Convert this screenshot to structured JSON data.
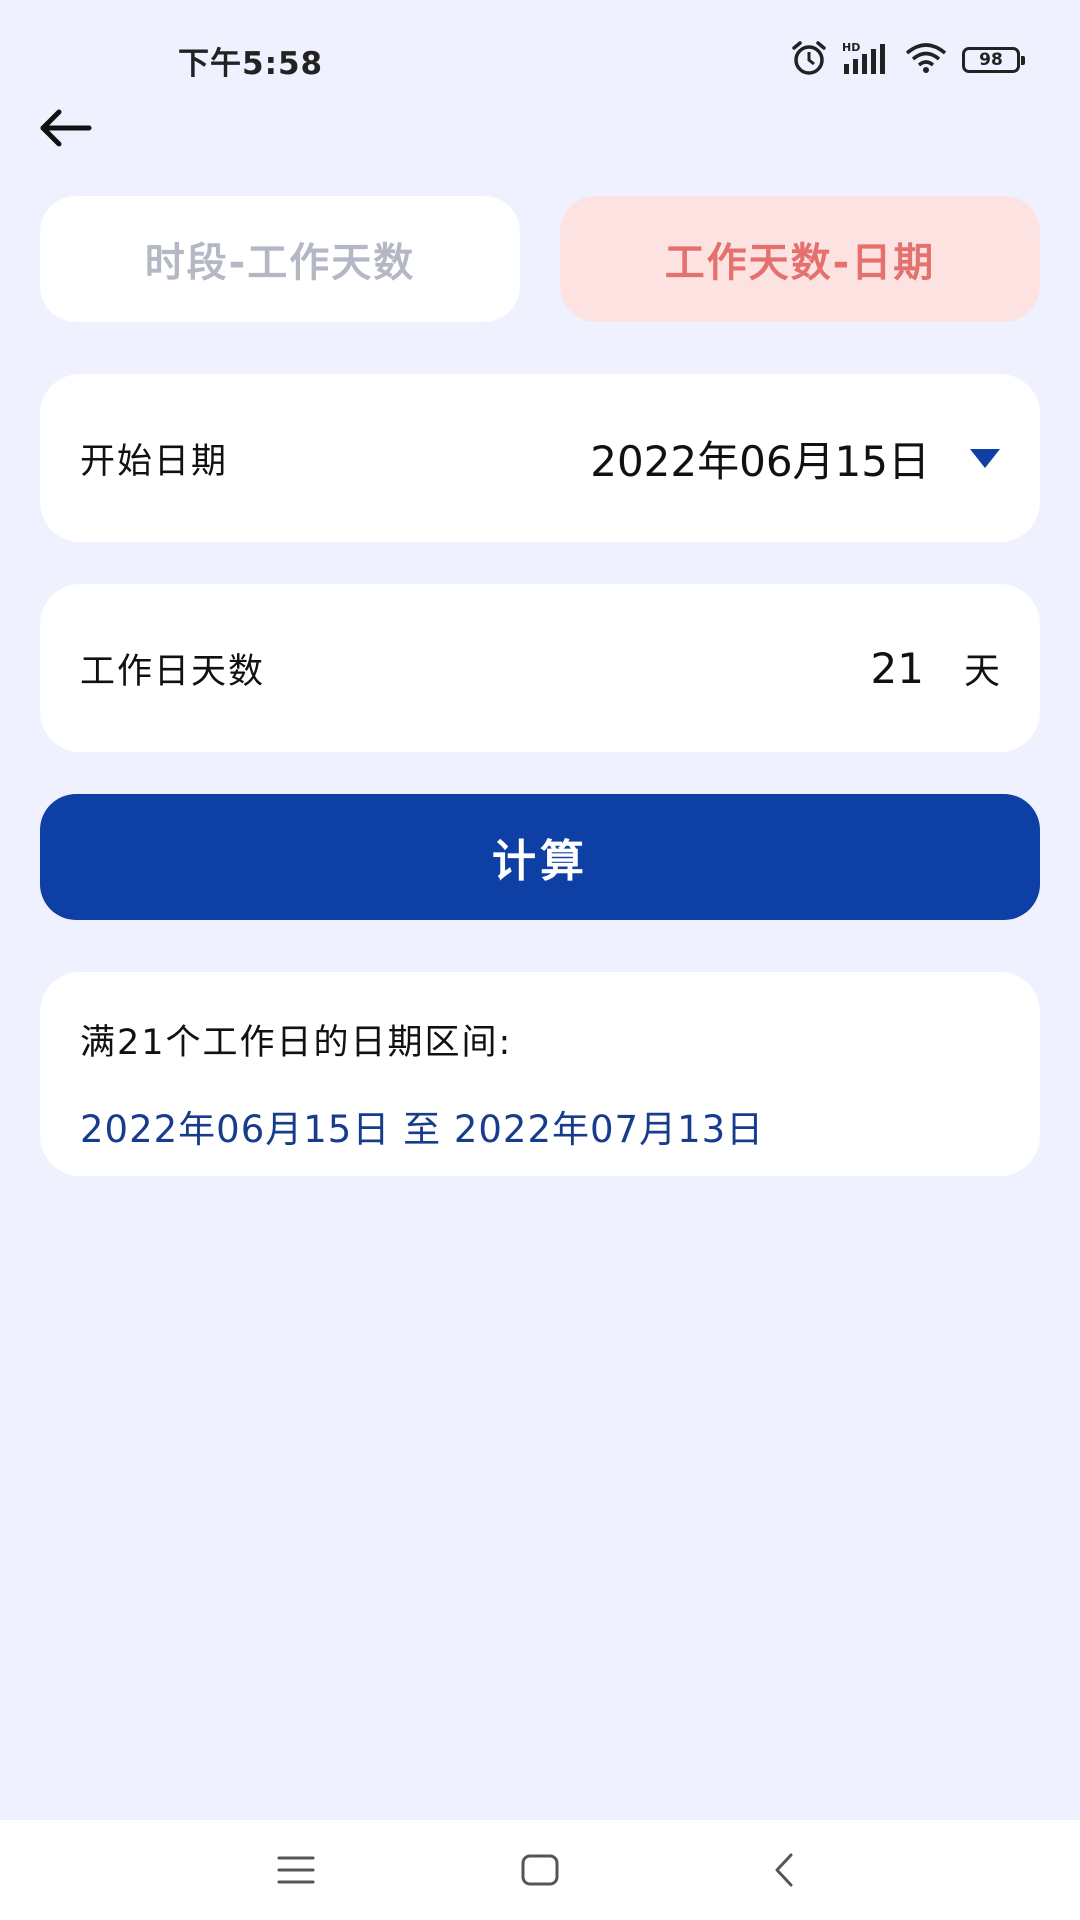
{
  "status_bar": {
    "time": "下午5:58",
    "battery_level": "98",
    "icons": [
      "alarm-icon",
      "hd-signal-icon",
      "wifi-icon",
      "battery-icon"
    ]
  },
  "header": {
    "back_icon": "arrow-left-icon"
  },
  "tabs": [
    {
      "label": "时段-工作天数",
      "selected": false
    },
    {
      "label": "工作天数-日期",
      "selected": true
    }
  ],
  "form": {
    "start_date": {
      "label": "开始日期",
      "value": "2022年06月15日",
      "icon": "caret-down-icon"
    },
    "workdays": {
      "label": "工作日天数",
      "value": "21",
      "unit": "天"
    }
  },
  "calculate_button": {
    "label": "计算"
  },
  "result": {
    "title": "满21个工作日的日期区间:",
    "range": "2022年06月15日 至 2022年07月13日"
  },
  "nav_bar": {
    "icons": [
      "menu-icon",
      "home-icon",
      "back-icon"
    ]
  },
  "colors": {
    "background": "#eff1fe",
    "primary": "#0e3fa5",
    "tab_active_bg": "#fde2e2",
    "tab_active_text": "#e5716f",
    "tab_inactive_text": "#b4b8c4",
    "result_text": "#173c8c"
  }
}
